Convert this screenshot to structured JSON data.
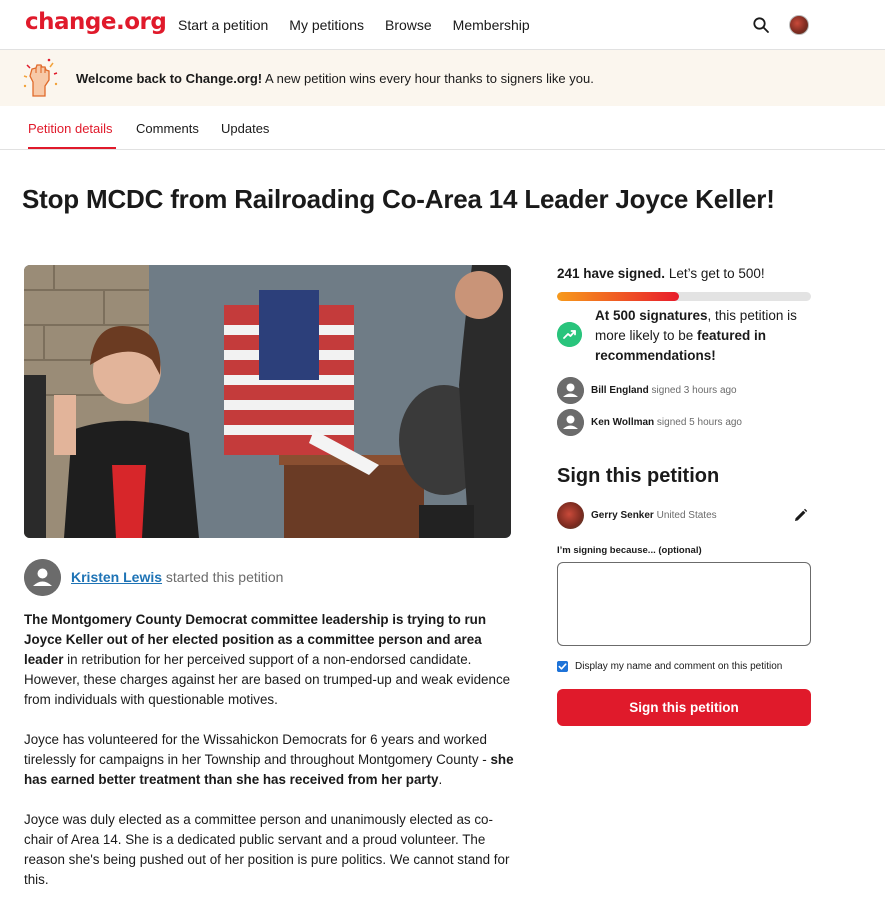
{
  "header": {
    "logo": "change.org",
    "nav": [
      "Start a petition",
      "My petitions",
      "Browse",
      "Membership"
    ],
    "icons": [
      "search-icon",
      "user-avatar"
    ]
  },
  "banner": {
    "bold": "Welcome back to Change.org!",
    "text": " A new petition wins every hour thanks to signers like you.",
    "icon": "raised-fist-celebration-icon"
  },
  "tabs": [
    {
      "label": "Petition details",
      "active": true
    },
    {
      "label": "Comments",
      "active": false
    },
    {
      "label": "Updates",
      "active": false
    }
  ],
  "petition": {
    "title": "Stop MCDC from Railroading Co-Area 14 Leader Joyce Keller!",
    "starter_name": "Kristen Lewis",
    "starter_suffix": " started this petition",
    "body": [
      [
        {
          "b": true,
          "t": "The Montgomery County Democrat committee leadership is trying to run Joyce Keller out of her elected position as a committee person and area leader"
        },
        {
          "b": false,
          "t": " in retribution for her perceived support of a non-endorsed candidate. However, these charges against her are based on trumped-up and weak evidence from individuals with questionable motives."
        }
      ],
      [
        {
          "b": false,
          "t": "Joyce has volunteered for the Wissahickon Democrats for 6 years and worked tirelessly for campaigns in her Township and throughout Montgomery County - "
        },
        {
          "b": true,
          "t": "she has earned better treatment than she has received from her party"
        },
        {
          "b": false,
          "t": "."
        }
      ],
      [
        {
          "b": false,
          "t": "Joyce was duly elected as a committee person and unanimously elected as co-chair of Area 14. She is a dedicated public servant and a proud volunteer. The reason she's being pushed out of her position is pure politics. We cannot stand for this."
        }
      ]
    ]
  },
  "sidebar": {
    "signed_count": "241 have signed.",
    "signed_goal": " Let’s get to 500!",
    "progress_fraction": 0.48,
    "colors": {
      "accent": "#e01a2b",
      "progress_start": "#f79a1b",
      "trend": "#29c47c",
      "link": "#1e73b5"
    },
    "milestone": [
      {
        "b": true,
        "t": "At 500 signatures"
      },
      {
        "b": false,
        "t": ", this petition is more likely to be "
      },
      {
        "b": true,
        "t": "featured in recommendations!"
      }
    ],
    "recent_signers": [
      {
        "name": "Bill England",
        "when": " signed 3 hours ago"
      },
      {
        "name": "Ken Wollman",
        "when": " signed 5 hours ago"
      }
    ],
    "sign_heading": "Sign this petition",
    "signer_name": "Gerry Senker",
    "signer_location": " United States",
    "reason_label": "I’m signing because... (optional)",
    "reason_value": "",
    "display_checkbox_checked": true,
    "display_label": "Display my name and comment on this petition",
    "sign_button": "Sign this petition"
  }
}
